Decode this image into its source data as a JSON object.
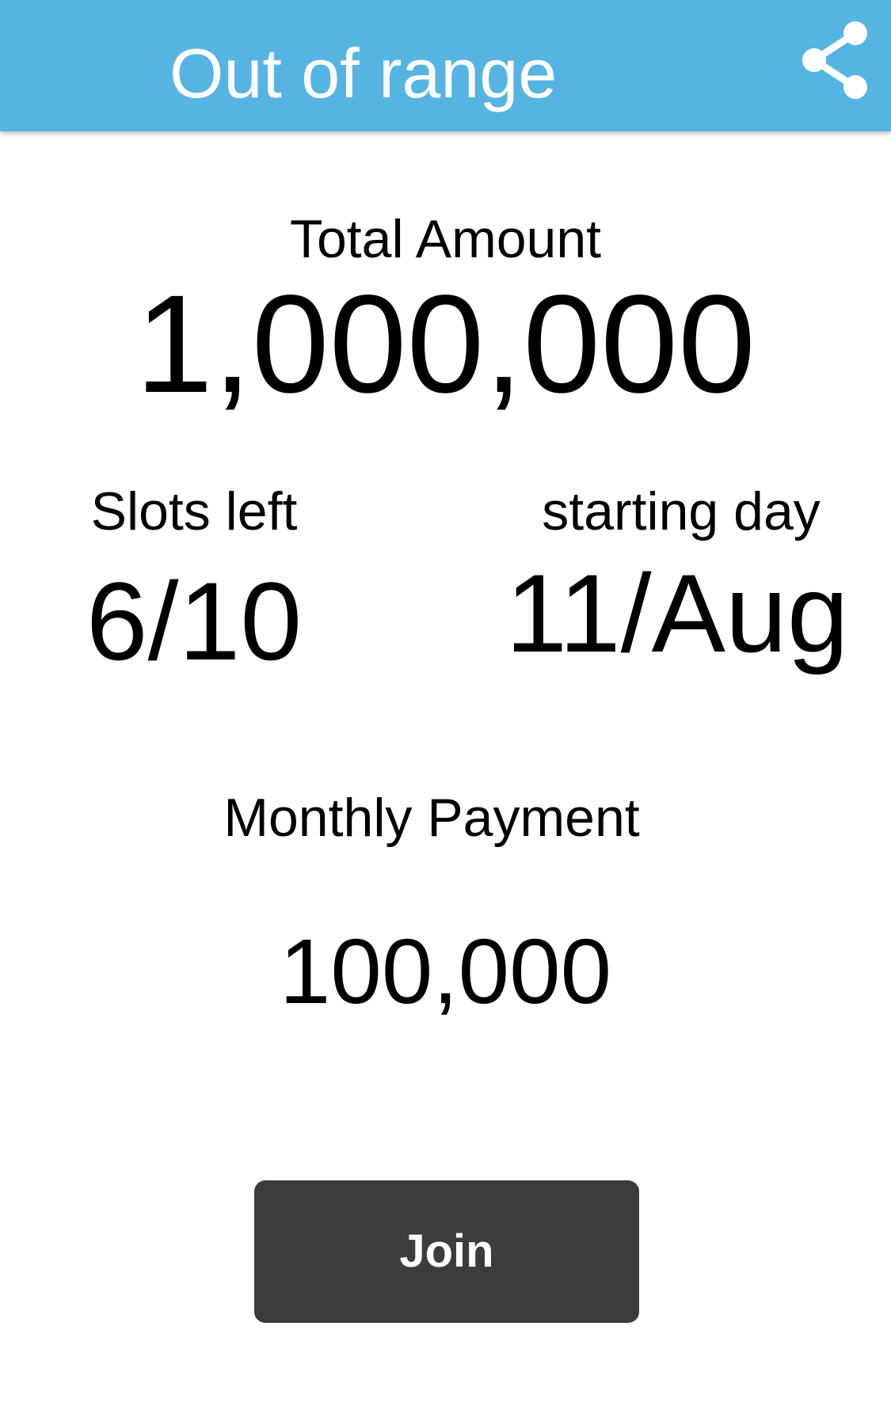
{
  "app_bar": {
    "title": "Out of range",
    "share_icon": "share-icon",
    "color": "#56B4E2"
  },
  "total_amount": {
    "label": "Total Amount",
    "value": "1,000,000"
  },
  "slots_left": {
    "label": "Slots left",
    "value": "6/10"
  },
  "starting_day": {
    "label": "starting day",
    "value": "11/Aug"
  },
  "monthly_payment": {
    "label": "Monthly Payment",
    "value": "100,000"
  },
  "join_button": {
    "label": "Join",
    "color": "#3C3C3C"
  }
}
